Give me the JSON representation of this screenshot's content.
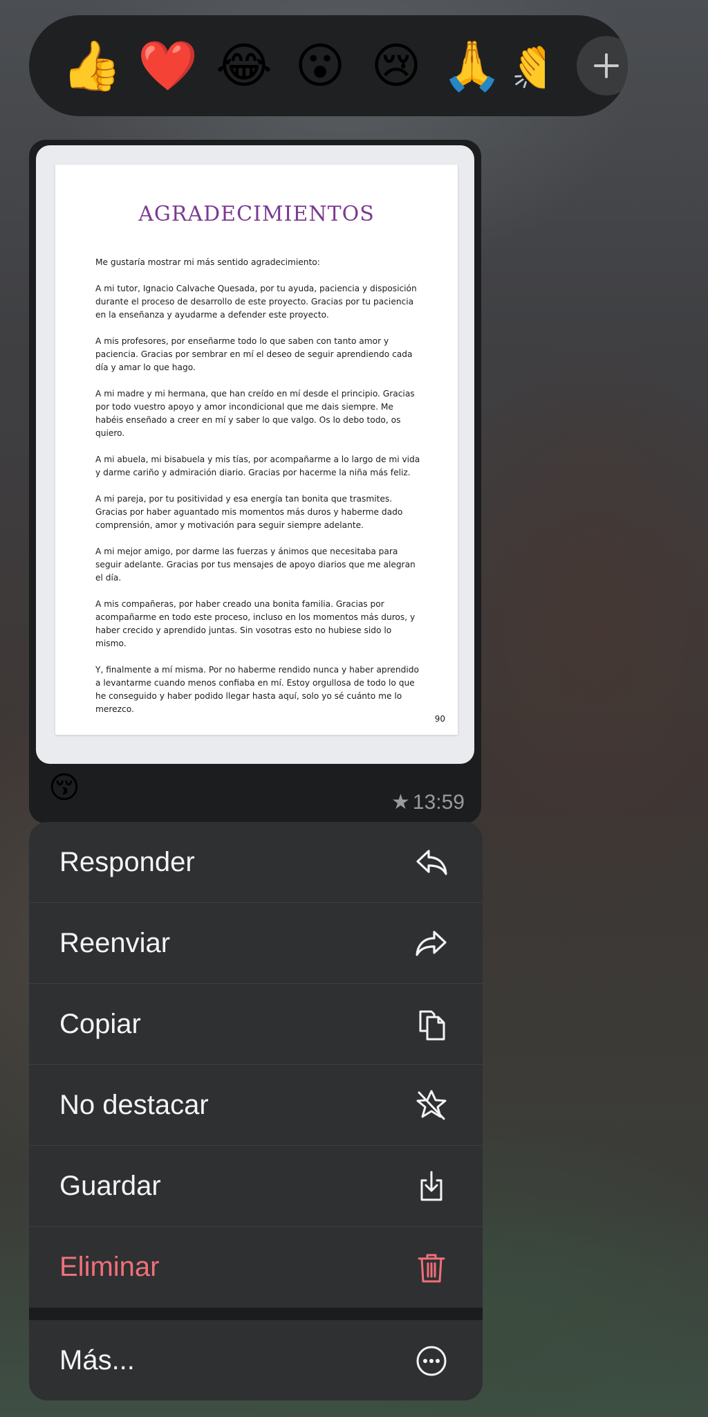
{
  "reactions": {
    "emojis": [
      "👍",
      "❤️",
      "😂",
      "😮",
      "😢",
      "🙏",
      "👏"
    ],
    "add_label": "+"
  },
  "message": {
    "document": {
      "title": "AGRADECIMIENTOS",
      "paragraphs": [
        "Me gustaría mostrar mi más sentido agradecimiento:",
        "A mi tutor, Ignacio Calvache Quesada, por tu ayuda, paciencia y disposición durante el proceso de desarrollo de este proyecto. Gracias por tu paciencia en la enseñanza y ayudarme a defender este proyecto.",
        "A mis profesores, por enseñarme todo lo que saben con tanto amor y paciencia. Gracias por sembrar en mí el deseo de seguir aprendiendo cada día y amar lo que hago.",
        "A mi madre y mi hermana, que han creído en mí desde el principio. Gracias por todo vuestro apoyo y amor incondicional que me dais siempre. Me habéis enseñado a creer en mí y saber lo que valgo. Os lo debo todo, os quiero.",
        "A mi abuela, mi bisabuela y mis tías, por acompañarme a lo largo de mi vida y darme cariño y admiración diario. Gracias por hacerme la niña más feliz.",
        "A mi pareja, por tu positividad y esa energía tan bonita que trasmites. Gracias por haber aguantado mis momentos más duros y haberme dado comprensión, amor y motivación para seguir siempre adelante.",
        "A mi mejor amigo, por darme las fuerzas y ánimos que necesitaba para seguir adelante. Gracias por tus mensajes de apoyo diarios que me alegran el día.",
        "A mis compañeras, por haber creado una bonita familia. Gracias por acompañarme en todo este proceso, incluso en los momentos más duros, y haber crecido y aprendido juntas. Sin vosotras esto no hubiese sido lo mismo.",
        "Y, finalmente a mí misma. Por no haberme rendido nunca y haber aprendido a levantarme cuando menos confiaba en mí. Estoy orgullosa de todo lo que he conseguido y haber podido llegar hasta aquí, solo yo sé cuánto me lo merezco."
      ],
      "page_number": "90"
    },
    "reaction": "😚",
    "star": "★",
    "time": "13:59"
  },
  "menu": {
    "items": [
      {
        "label": "Responder",
        "icon": "reply-icon"
      },
      {
        "label": "Reenviar",
        "icon": "forward-icon"
      },
      {
        "label": "Copiar",
        "icon": "copy-icon"
      },
      {
        "label": "No destacar",
        "icon": "unstar-icon"
      },
      {
        "label": "Guardar",
        "icon": "save-icon"
      },
      {
        "label": "Eliminar",
        "icon": "trash-icon"
      },
      {
        "label": "Más...",
        "icon": "more-icon"
      }
    ]
  },
  "colors": {
    "danger": "#f0707a",
    "title_purple": "#7b3a91"
  }
}
